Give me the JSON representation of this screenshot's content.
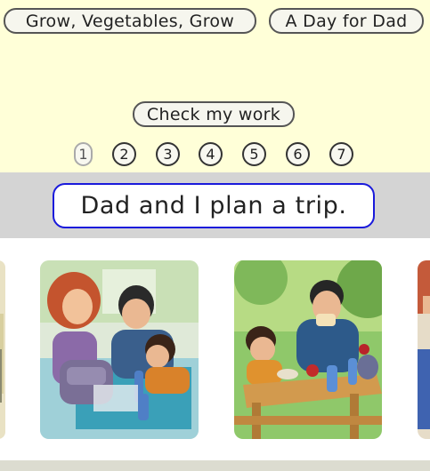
{
  "books": [
    {
      "title": "Grow, Vegetables, Grow"
    },
    {
      "title": "A Day for Dad"
    }
  ],
  "check_button": {
    "label": "Check my work"
  },
  "pages": [
    "1",
    "2",
    "3",
    "4",
    "5",
    "6",
    "7"
  ],
  "current_page": "1",
  "sentence": "Dad and I plan a trip.",
  "illustrations": [
    {
      "icon": "partial-illustration-left"
    },
    {
      "icon": "family-packing-backpack-illustration"
    },
    {
      "icon": "family-picnic-illustration"
    },
    {
      "icon": "partial-illustration-right"
    }
  ],
  "colors": {
    "background": "#ffffd8",
    "band": "#d4d4d4",
    "sentence_border": "#1a1adb"
  }
}
